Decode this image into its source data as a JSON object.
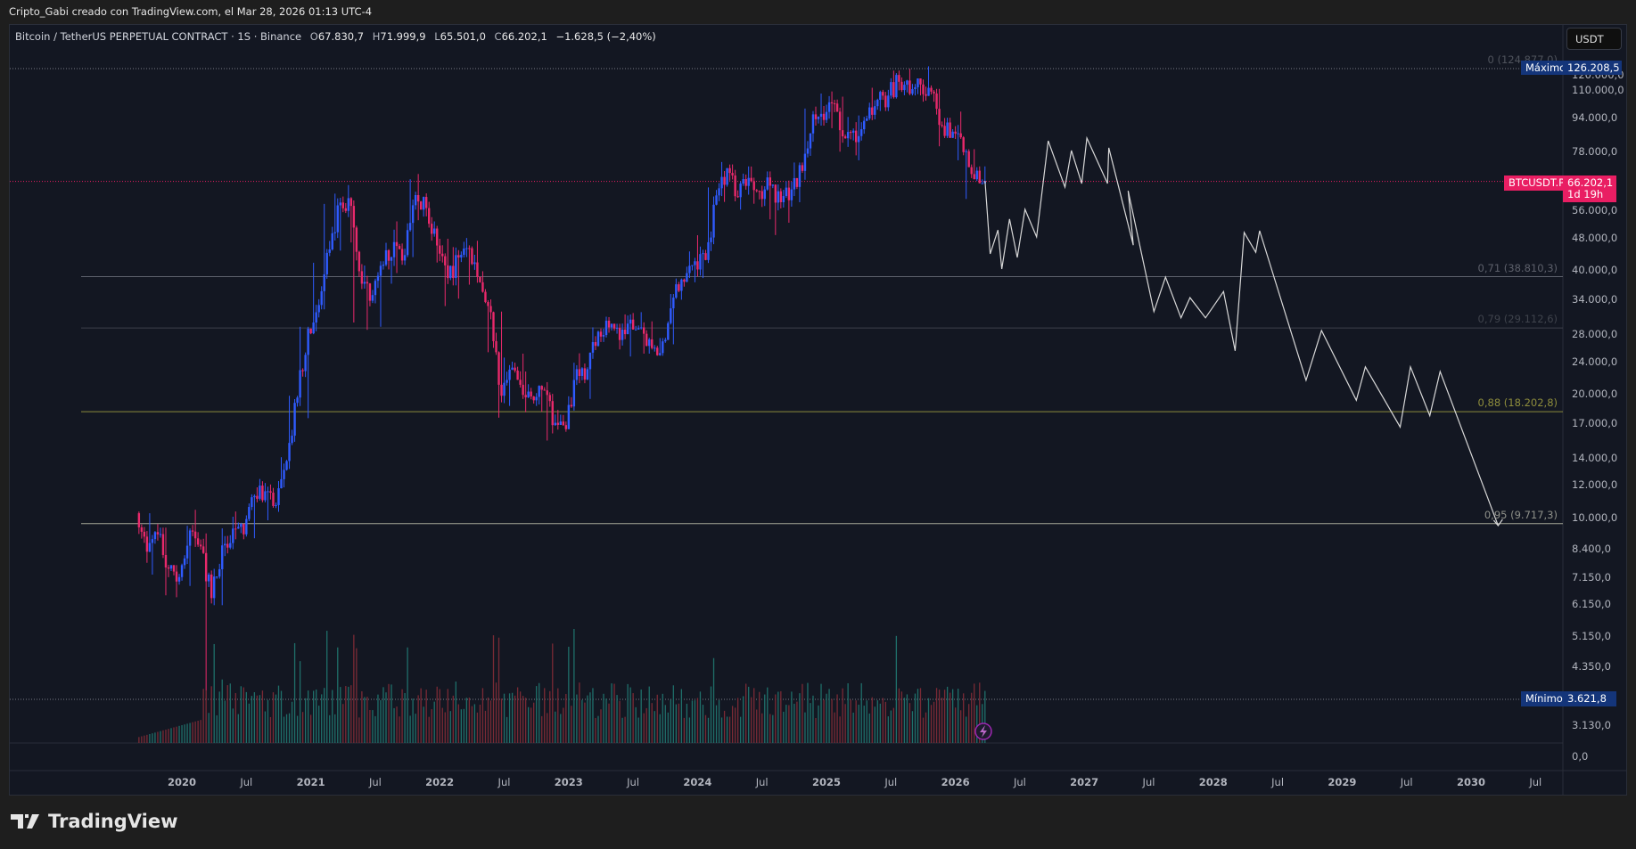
{
  "topline": "Cripto_Gabi creado con TradingView.com, el Mar 28, 2026 01:13 UTC-4",
  "legend": {
    "symbol": "Bitcoin / TetherUS PERPETUAL CONTRACT · 1S · Binance",
    "o_key": "O",
    "o": "67.830,7",
    "h_key": "H",
    "h": "71.999,9",
    "l_key": "L",
    "l": "65.501,0",
    "c_key": "C",
    "c": "66.202,1",
    "change": "−1.628,5 (−2,40%)"
  },
  "currency_button": "USDT",
  "badges": {
    "max_label": "Máximo",
    "max_value": "126.208,5",
    "symbol_label": "BTCUSDT.P",
    "last_value": "66.202,1",
    "countdown": "1d 19h",
    "min_label": "Mínimo",
    "min_value": "3.621,8"
  },
  "volume_axis_label": "0,0",
  "logo_text": "TradingView",
  "colors": {
    "up": "#2f5bff",
    "down": "#e9296b",
    "vol_up": "#1f6f6a",
    "vol_down": "#7a2a35",
    "projection": "#d8d8d8",
    "price_line": "#e91e63",
    "badge_navy": "#14357a"
  },
  "chart_data": {
    "type": "candlestick",
    "scale": "log",
    "ylim": [
      3130,
      130000
    ],
    "xlim": [
      2019.3,
      2030.85
    ],
    "price_ticks": [
      {
        "label": "120.000,0",
        "value": 120000
      },
      {
        "label": "110.000,0",
        "value": 110000
      },
      {
        "label": "94.000,0",
        "value": 94000
      },
      {
        "label": "78.000,0",
        "value": 78000
      },
      {
        "label": "56.000,0",
        "value": 56000
      },
      {
        "label": "48.000,0",
        "value": 48000
      },
      {
        "label": "40.000,0",
        "value": 40000
      },
      {
        "label": "34.000,0",
        "value": 34000
      },
      {
        "label": "28.000,0",
        "value": 28000
      },
      {
        "label": "24.000,0",
        "value": 24000
      },
      {
        "label": "20.000,0",
        "value": 20000
      },
      {
        "label": "17.000,0",
        "value": 17000
      },
      {
        "label": "14.000,0",
        "value": 14000
      },
      {
        "label": "12.000,0",
        "value": 12000
      },
      {
        "label": "10.000,0",
        "value": 10000
      },
      {
        "label": "8.400,0",
        "value": 8400
      },
      {
        "label": "7.150,0",
        "value": 7150
      },
      {
        "label": "6.150,0",
        "value": 6150
      },
      {
        "label": "5.150,0",
        "value": 5150
      },
      {
        "label": "4.350,0",
        "value": 4350
      },
      {
        "label": "3.130,0",
        "value": 3130
      }
    ],
    "time_ticks": [
      {
        "label": "2020",
        "t": 2020
      },
      {
        "label": "Jul",
        "t": 2020.5
      },
      {
        "label": "2021",
        "t": 2021
      },
      {
        "label": "Jul",
        "t": 2021.5
      },
      {
        "label": "2022",
        "t": 2022
      },
      {
        "label": "Jul",
        "t": 2022.5
      },
      {
        "label": "2023",
        "t": 2023
      },
      {
        "label": "Jul",
        "t": 2023.5
      },
      {
        "label": "2024",
        "t": 2024
      },
      {
        "label": "Jul",
        "t": 2024.5
      },
      {
        "label": "2025",
        "t": 2025
      },
      {
        "label": "Jul",
        "t": 2025.5
      },
      {
        "label": "2026",
        "t": 2026
      },
      {
        "label": "Jul",
        "t": 2026.5
      },
      {
        "label": "2027",
        "t": 2027
      },
      {
        "label": "Jul",
        "t": 2027.5
      },
      {
        "label": "2028",
        "t": 2028
      },
      {
        "label": "Jul",
        "t": 2028.5
      },
      {
        "label": "2029",
        "t": 2029
      },
      {
        "label": "Jul",
        "t": 2029.5
      },
      {
        "label": "2030",
        "t": 2030
      },
      {
        "label": "Jul",
        "t": 2030.5
      }
    ],
    "start": 2019.667,
    "monthly_close_high_low": [
      [
        8300,
        10400,
        7800
      ],
      [
        9150,
        10300,
        7300
      ],
      [
        7550,
        9500,
        6500
      ],
      [
        7200,
        7700,
        6430
      ],
      [
        9350,
        9600,
        6850
      ],
      [
        8550,
        10500,
        8400
      ],
      [
        6400,
        9200,
        3622
      ],
      [
        8600,
        9460,
        6150
      ],
      [
        9450,
        10100,
        8100
      ],
      [
        9150,
        10400,
        8900
      ],
      [
        11350,
        11450,
        8950
      ],
      [
        11650,
        12480,
        10950
      ],
      [
        10780,
        12100,
        9900
      ],
      [
        13800,
        14100,
        10380
      ],
      [
        19700,
        19900,
        13200
      ],
      [
        29000,
        29300,
        17550
      ],
      [
        33100,
        41950,
        28100
      ],
      [
        45200,
        58350,
        32300
      ],
      [
        58800,
        61800,
        44900
      ],
      [
        57700,
        64850,
        47000
      ],
      [
        37300,
        59500,
        30000
      ],
      [
        35000,
        41300,
        28800
      ],
      [
        41500,
        42300,
        29300
      ],
      [
        47100,
        50500,
        37300
      ],
      [
        43800,
        52900,
        39600
      ],
      [
        61300,
        67000,
        43300
      ],
      [
        57000,
        69000,
        53250
      ],
      [
        46200,
        59050,
        42000
      ],
      [
        38500,
        47990,
        32900
      ],
      [
        43200,
        45800,
        34300
      ],
      [
        45500,
        48200,
        37100
      ],
      [
        37600,
        47450,
        37500
      ],
      [
        31800,
        40000,
        25400
      ],
      [
        19900,
        31900,
        17600
      ],
      [
        23300,
        24650,
        18800
      ],
      [
        20000,
        25200,
        19550
      ],
      [
        19400,
        22800,
        18150
      ],
      [
        20500,
        21100,
        18200
      ],
      [
        17100,
        21480,
        15480
      ],
      [
        16500,
        18380,
        16260
      ],
      [
        23100,
        23950,
        16500
      ],
      [
        23100,
        25250,
        21350
      ],
      [
        28500,
        29200,
        19550
      ],
      [
        29200,
        31000,
        26900
      ],
      [
        27200,
        29800,
        25800
      ],
      [
        30500,
        31400,
        24800
      ],
      [
        29200,
        31800,
        28850
      ],
      [
        26000,
        30200,
        25200
      ],
      [
        27000,
        27500,
        24900
      ],
      [
        34500,
        35200,
        26550
      ],
      [
        37700,
        38400,
        34100
      ],
      [
        42300,
        44700,
        37600
      ],
      [
        42600,
        48950,
        38500
      ],
      [
        61200,
        64000,
        41900
      ],
      [
        71300,
        73800,
        59000
      ],
      [
        60600,
        72800,
        59200
      ],
      [
        67500,
        72000,
        56500
      ],
      [
        62700,
        71950,
        58400
      ],
      [
        64600,
        70000,
        53500
      ],
      [
        58900,
        65100,
        49000
      ],
      [
        63300,
        66500,
        52500
      ],
      [
        70200,
        73600,
        58900
      ],
      [
        96400,
        99600,
        66800
      ],
      [
        93400,
        108350,
        90500
      ],
      [
        102400,
        109600,
        89200
      ],
      [
        84300,
        106450,
        78200
      ],
      [
        82500,
        95000,
        76600
      ],
      [
        94200,
        95800,
        74500
      ],
      [
        104600,
        111900,
        93300
      ],
      [
        107100,
        110600,
        98200
      ],
      [
        115700,
        123200,
        105300
      ],
      [
        108200,
        124450,
        107300
      ],
      [
        114000,
        117900,
        107200
      ],
      [
        109500,
        126208,
        103500
      ],
      [
        90400,
        111200,
        80600
      ],
      [
        87500,
        94600,
        84400
      ],
      [
        78000,
        97900,
        74500
      ],
      [
        67000,
        79300,
        60000
      ],
      [
        66202,
        72000,
        65501
      ]
    ],
    "first_open": 10300,
    "last_price": 66202.1,
    "max_price": 126208.5,
    "min_price": 3621.8,
    "fib_levels": [
      {
        "label": "0 (124.877,0)",
        "price": 124877,
        "color": "#4a4e58",
        "text_color": "#4f535c"
      },
      {
        "label": "0,71 (38.810,3)",
        "price": 38810.3,
        "color": "#5d606b",
        "text_color": "#5d606b"
      },
      {
        "label": "0,79 (29.112,6)",
        "price": 29112.6,
        "color": "#3e414b",
        "text_color": "#3f434c"
      },
      {
        "label": "0,88 (18.202,8)",
        "price": 18202.8,
        "color": "#8b8a3c",
        "text_color": "#8e8d3c"
      },
      {
        "label": "0,95 (9.717,3)",
        "price": 9717.3,
        "color": "#a6a898",
        "text_color": "#8f918a"
      }
    ],
    "projection": [
      [
        2026.23,
        66400
      ],
      [
        2026.27,
        44100
      ],
      [
        2026.33,
        50400
      ],
      [
        2026.36,
        40500
      ],
      [
        2026.42,
        53600
      ],
      [
        2026.48,
        43200
      ],
      [
        2026.54,
        56600
      ],
      [
        2026.63,
        48500
      ],
      [
        2026.72,
        83100
      ],
      [
        2026.85,
        64100
      ],
      [
        2026.9,
        78700
      ],
      [
        2026.98,
        65400
      ],
      [
        2027.02,
        84400
      ],
      [
        2027.18,
        65400
      ],
      [
        2027.19,
        79900
      ],
      [
        2027.38,
        46300
      ],
      [
        2027.34,
        62800
      ],
      [
        2027.54,
        31900
      ],
      [
        2027.63,
        38700
      ],
      [
        2027.75,
        30800
      ],
      [
        2027.82,
        34500
      ],
      [
        2027.94,
        30800
      ],
      [
        2028.08,
        35700
      ],
      [
        2028.17,
        25600
      ],
      [
        2028.24,
        49700
      ],
      [
        2028.33,
        44500
      ],
      [
        2028.36,
        50200
      ],
      [
        2028.72,
        21700
      ],
      [
        2028.84,
        28700
      ],
      [
        2029.11,
        19400
      ],
      [
        2029.18,
        23400
      ],
      [
        2029.45,
        16700
      ],
      [
        2029.53,
        23400
      ],
      [
        2029.68,
        17800
      ],
      [
        2029.76,
        22800
      ],
      [
        2030.21,
        9610
      ]
    ]
  }
}
